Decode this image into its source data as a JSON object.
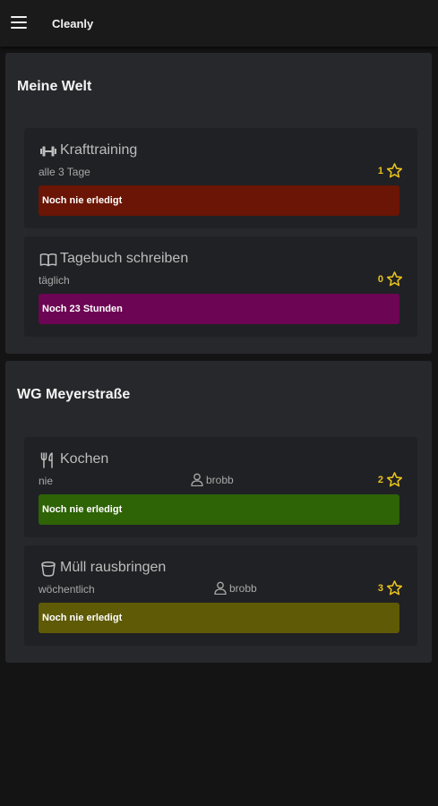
{
  "app": {
    "title": "Cleanly"
  },
  "groups": [
    {
      "title": "Meine Welt",
      "tasks": [
        {
          "icon": "dumbbell-icon",
          "name": "Krafttraining",
          "frequency": "alle 3 Tage",
          "user": "",
          "points": "1",
          "status": "Noch nie erledigt",
          "status_color": "#6a1505"
        },
        {
          "icon": "book-open-icon",
          "name": "Tagebuch schreiben",
          "frequency": "täglich",
          "user": "",
          "points": "0",
          "status": "Noch 23 Stunden",
          "status_color": "#6c0553"
        }
      ]
    },
    {
      "title": "WG Meyerstraße",
      "tasks": [
        {
          "icon": "utensils-icon",
          "name": "Kochen",
          "frequency": "nie",
          "user": "brobb",
          "points": "2",
          "status": "Noch nie erledigt",
          "status_color": "#2e6306"
        },
        {
          "icon": "bucket-icon",
          "name": "Müll rausbringen",
          "frequency": "wöchentlich",
          "user": "brobb",
          "points": "3",
          "status": "Noch nie erledigt",
          "status_color": "#5f5a06"
        }
      ]
    }
  ],
  "colors": {
    "background": "#141414",
    "card": "#27282b",
    "task_card": "#202124",
    "star": "#e8c21b"
  }
}
